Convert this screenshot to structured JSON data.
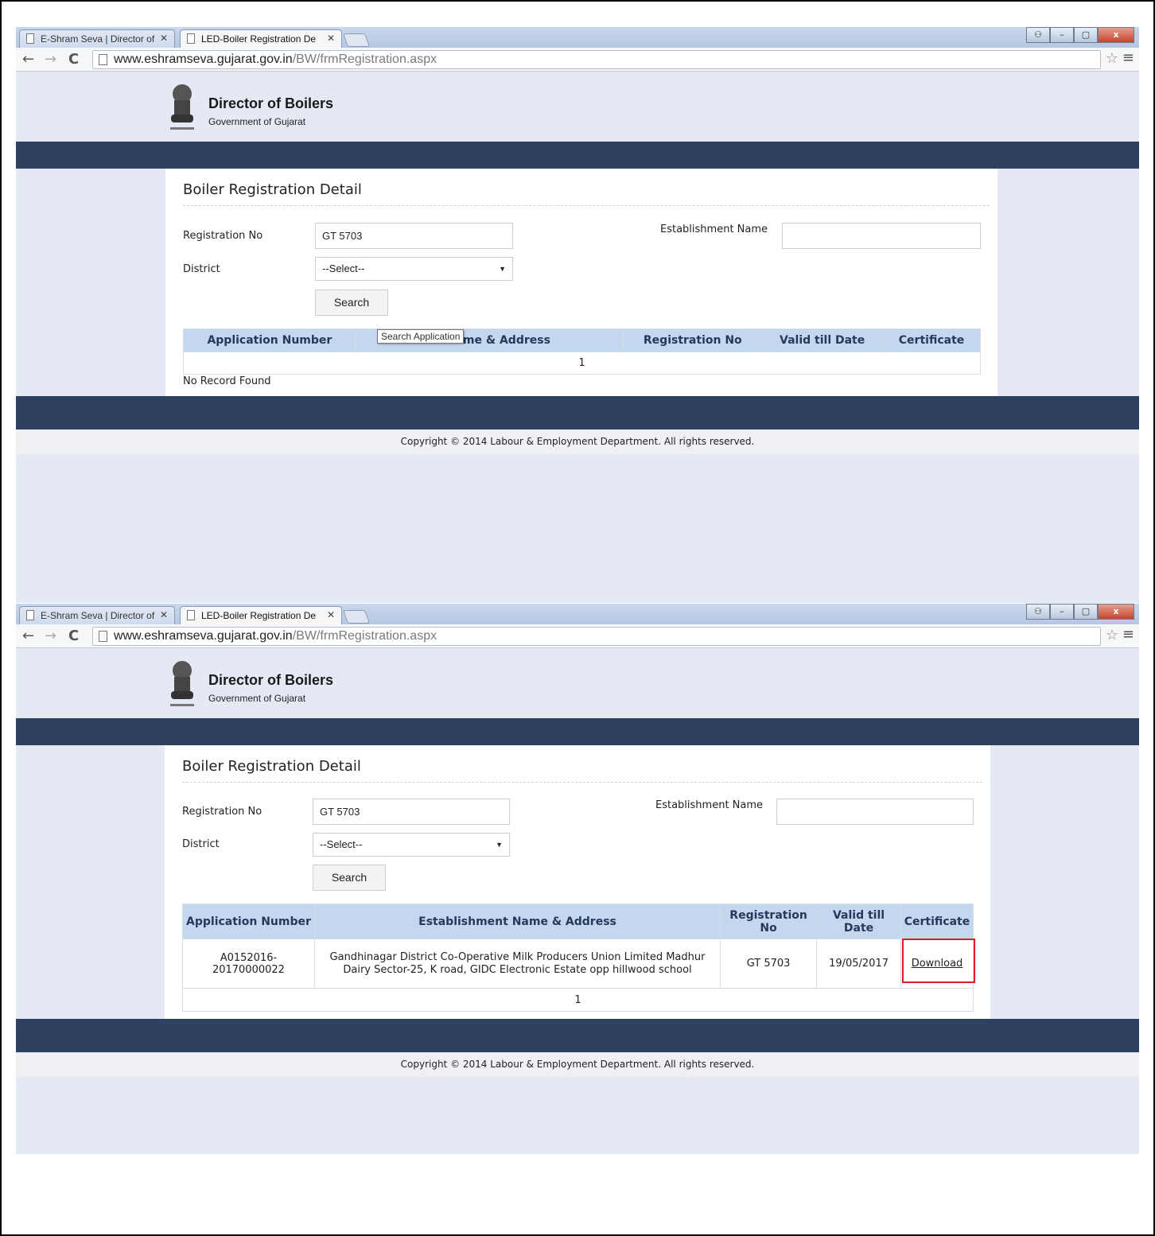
{
  "browser": {
    "tabs": [
      {
        "label": "E-Shram Seva | Director of",
        "close": "✕"
      },
      {
        "label": "LED-Boiler Registration De",
        "close": "✕"
      }
    ],
    "url_host": "www.eshramseva.gujarat.gov.in",
    "url_path": "/BW/frmRegistration.aspx"
  },
  "header": {
    "title": "Director of Boilers",
    "subtitle": "Government of Gujarat"
  },
  "form": {
    "title": "Boiler Registration Detail",
    "reg_label": "Registration No",
    "reg_value": "GT 5703",
    "est_label": "Establishment Name",
    "est_value": "",
    "district_label": "District",
    "district_value": "--Select--",
    "search_label": "Search",
    "tooltip": "Search Application"
  },
  "table1": {
    "headers": [
      "Application Number",
      "nt Name & Address",
      "Registration No",
      "Valid till Date",
      "Certificate"
    ],
    "pager": "1",
    "empty_message": "No Record Found"
  },
  "table2": {
    "headers": [
      "Application Number",
      "Establishment Name & Address",
      "Registration No",
      "Valid till Date",
      "Certificate"
    ],
    "row": {
      "application_number": "A0152016-20170000022",
      "establishment": "Gandhinagar District Co-Operative Milk Producers Union Limited Madhur Dairy Sector-25, K road, GIDC Electronic Estate opp hillwood school",
      "registration_no": "GT 5703",
      "valid_till": "19/05/2017",
      "certificate_link": "Download"
    },
    "pager": "1"
  },
  "footer": {
    "copyright": "Copyright © 2014 Labour & Employment Department. All rights reserved."
  },
  "colors": {
    "navbar": "#2e4161",
    "page_bg": "#e4e9f4",
    "table_header": "#c5d7ee",
    "highlight": "#e01b24"
  }
}
